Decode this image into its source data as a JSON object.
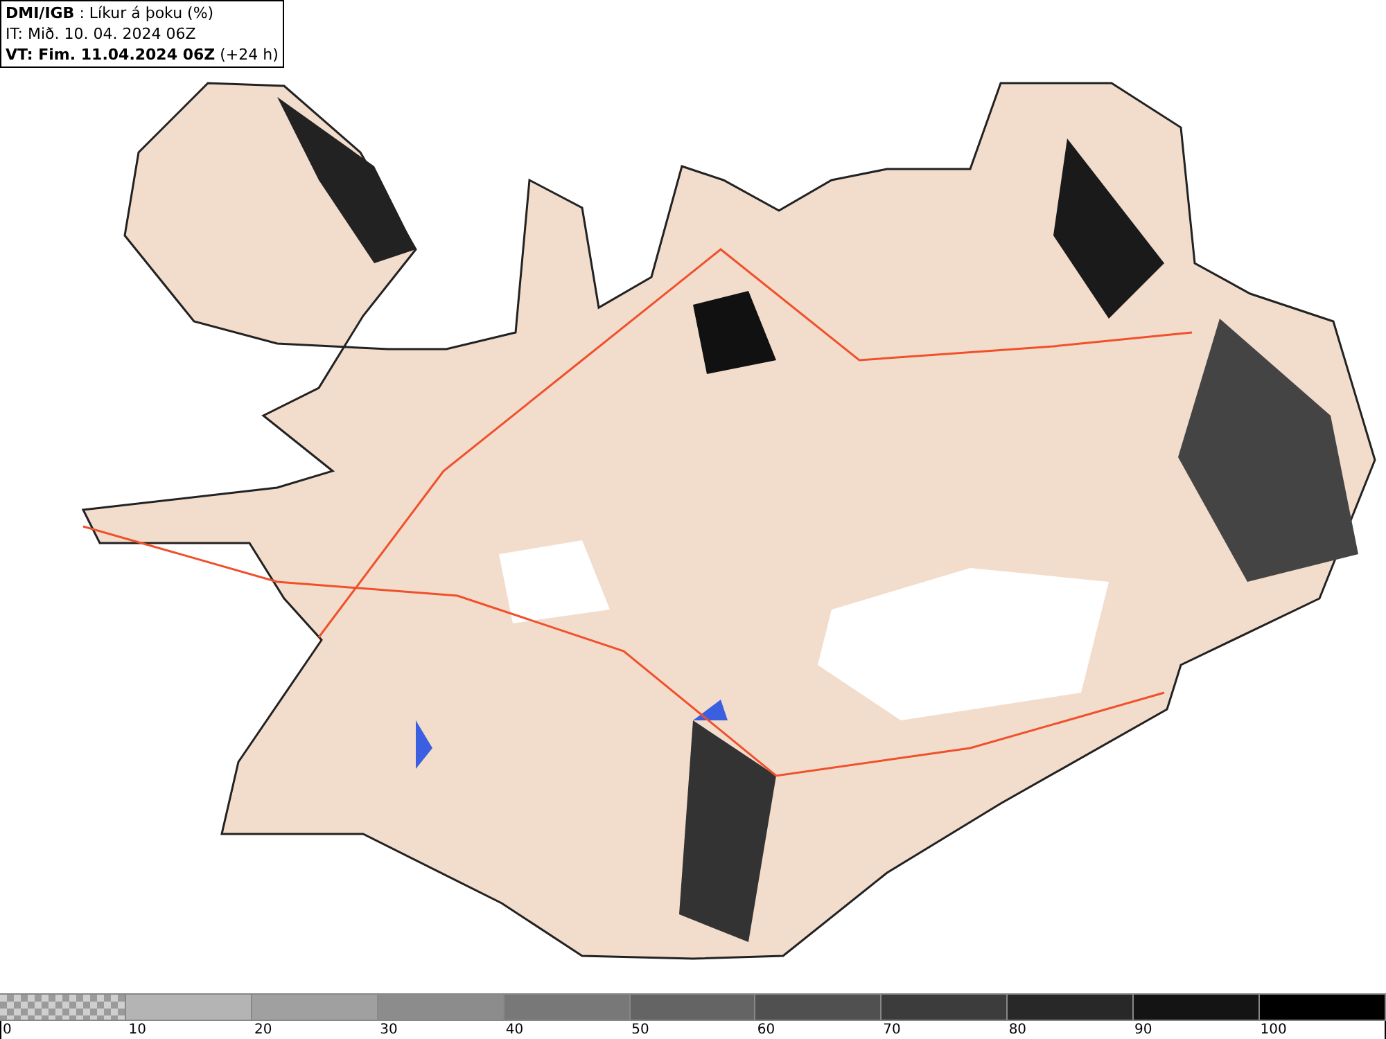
{
  "header": {
    "title": "**DMI/IGB** : Líkur á þoku (%)",
    "issue_time": "IT: Mið. 10. 04. 2024 06Z",
    "valid_time": "**VT: Fim. 11.04.2024 06Z** (+24 h)"
  },
  "legend": {
    "segments": [
      {
        "kind": "checker",
        "color": "#9a9a9a"
      },
      {
        "kind": "solid",
        "color": "#b4b4b4"
      },
      {
        "kind": "solid",
        "color": "#a0a0a0"
      },
      {
        "kind": "solid",
        "color": "#8c8c8c"
      },
      {
        "kind": "solid",
        "color": "#787878"
      },
      {
        "kind": "solid",
        "color": "#646464"
      },
      {
        "kind": "solid",
        "color": "#505050"
      },
      {
        "kind": "solid",
        "color": "#3c3c3c"
      },
      {
        "kind": "solid",
        "color": "#282828"
      },
      {
        "kind": "solid",
        "color": "#141414"
      },
      {
        "kind": "solid",
        "color": "#000000"
      }
    ],
    "labels": [
      "0",
      "10",
      "20",
      "30",
      "40",
      "50",
      "60",
      "70",
      "80",
      "90",
      "100"
    ]
  }
}
